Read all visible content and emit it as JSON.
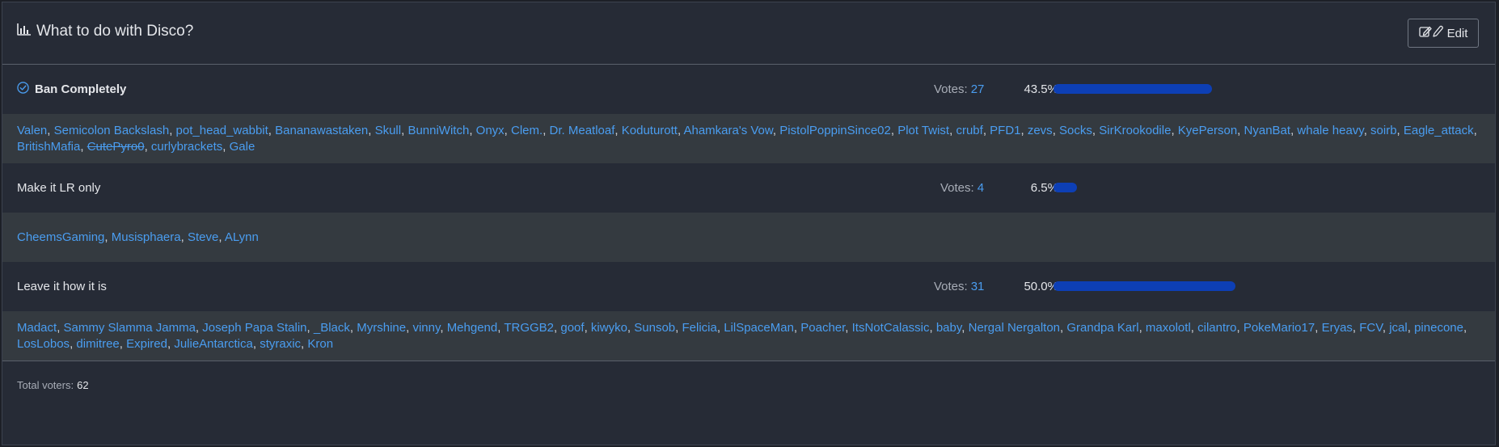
{
  "poll": {
    "title": "What to do with Disco?",
    "edit_label": "Edit",
    "votes_label": "Votes:",
    "total_label": "Total voters:",
    "total_value": "62",
    "options": [
      {
        "label": "Ban Completely",
        "votes": "27",
        "percent_text": "43.5%",
        "percent": 43.5,
        "selected": true,
        "voters": [
          "Valen",
          "Semicolon Backslash",
          "pot_head_wabbit",
          "Bananawastaken",
          "Skull",
          "BunniWitch",
          "Onyx",
          "Clem.",
          "Dr. Meatloaf",
          "Koduturott",
          "Ahamkara's Vow",
          "PistolPoppinSince02",
          "Plot Twist",
          "crubf",
          "PFD1",
          "zevs",
          "Socks",
          "SirKrookodile",
          "KyePerson",
          "NyanBat",
          "whale heavy",
          "soirb",
          "Eagle_attack",
          "BritishMafia",
          "CutePyro0",
          "curlybrackets",
          "Gale"
        ],
        "struck_voters": [
          "CutePyro0"
        ]
      },
      {
        "label": "Make it LR only",
        "votes": "4",
        "percent_text": "6.5%",
        "percent": 6.5,
        "selected": false,
        "voters": [
          "CheemsGaming",
          "Musisphaera",
          "Steve",
          "ALynn"
        ],
        "struck_voters": []
      },
      {
        "label": "Leave it how it is",
        "votes": "31",
        "percent_text": "50.0%",
        "percent": 50.0,
        "selected": false,
        "voters": [
          "Madact",
          "Sammy Slamma Jamma",
          "Joseph Papa Stalin",
          "_Black",
          "Myrshine",
          "vinny",
          "Mehgend",
          "TRGGB2",
          "goof",
          "kiwyko",
          "Sunsob",
          "Felicia",
          "LilSpaceMan",
          "Poacher",
          "ItsNotCalassic",
          "baby",
          "Nergal Nergalton",
          "Grandpa Karl",
          "maxolotl",
          "cilantro",
          "PokeMario17",
          "Eryas",
          "FCV",
          "jcal",
          "pinecone",
          "LosLobos",
          "dimitree",
          "Expired",
          "JulieAntarctica",
          "styraxic",
          "Kron"
        ],
        "struck_voters": []
      }
    ]
  },
  "colors": {
    "bar": "#0d3fb5",
    "link": "#4a9df0",
    "panel": "#262b36",
    "voters_bg": "#343a40"
  },
  "icons": {
    "title": "bar-chart-icon",
    "edit": "edit-pencil-icon",
    "selected": "check-circle-icon"
  }
}
